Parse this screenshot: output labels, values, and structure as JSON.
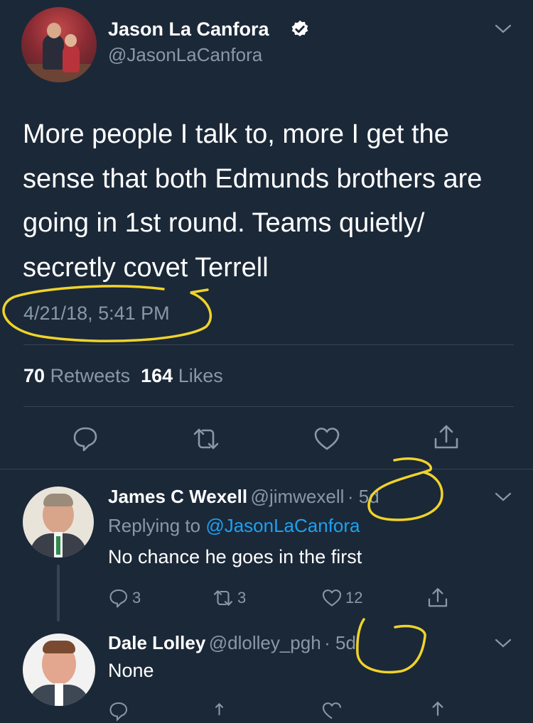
{
  "tweet": {
    "author_name": "Jason La Canfora",
    "author_handle": "@JasonLaCanfora",
    "text": "More people I talk to, more I get the sense that both Edmunds brothers are going in 1st round. Teams quietly/ secretly covet Terrell",
    "line1": "More people I talk to, more I get the",
    "line2": "sense that both Edmunds brothers are",
    "line3": "going in 1st round. Teams quietly/",
    "line4": "secretly covet Terrell",
    "timestamp": "4/21/18, 5:41 PM",
    "retweets_count": "70",
    "retweets_label": "Retweets",
    "likes_count": "164",
    "likes_label": "Likes"
  },
  "replies": [
    {
      "name": "James C Wexell",
      "handle": "@jimwexell",
      "age": "· 5d",
      "replying_prefix": "Replying to",
      "replying_to": "@JasonLaCanfora",
      "text": "No chance he goes in the first",
      "reply_count": "3",
      "retweet_count": "3",
      "like_count": "12"
    },
    {
      "name": "Dale Lolley",
      "handle": "@dlolley_pgh",
      "age": "· 5d",
      "text": "None"
    }
  ],
  "colors": {
    "background": "#1b2838",
    "secondary_text": "#8899a6",
    "link": "#1da1f2",
    "annotation": "#f0d32a",
    "verified": "#ffffff"
  },
  "icons": [
    "verified-badge-icon",
    "chevron-down-icon",
    "reply-icon",
    "retweet-icon",
    "like-icon",
    "share-icon"
  ]
}
